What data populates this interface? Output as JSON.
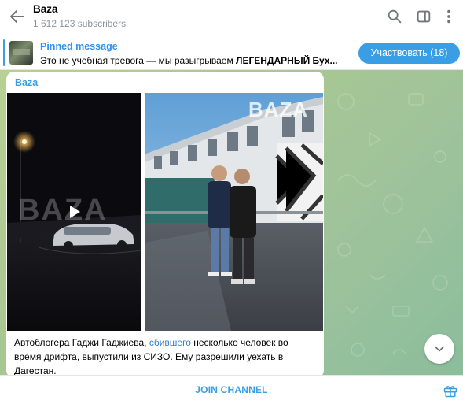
{
  "header": {
    "channel_name": "Baza",
    "subscribers": "1 612 123 subscribers",
    "icons": [
      "back-arrow-icon",
      "search-icon",
      "sidebar-toggle-icon",
      "more-vertical-icon"
    ]
  },
  "pinned": {
    "title": "Pinned message",
    "text_plain": "Это не учебная тревога — мы разыгрываем ",
    "text_bold": "ЛЕГЕНДАРНЫЙ Бух...",
    "button_label": "Участвовать (18)"
  },
  "message": {
    "sender": "Baza",
    "video_watermark": "BAZA",
    "photo_watermark": "BAZA",
    "caption_part1": "Автоблогера Гаджи Гаджиева, ",
    "caption_link": "сбившего",
    "caption_part2": " несколько человек во время дрифта, выпустили из СИЗО. Ему разрешили уехать в Дагестан."
  },
  "footer": {
    "join_label": "JOIN CHANNEL",
    "gift_icon": "gift-icon"
  },
  "colors": {
    "accent": "#3a9ee5",
    "chat_bg": "#a9c791"
  }
}
